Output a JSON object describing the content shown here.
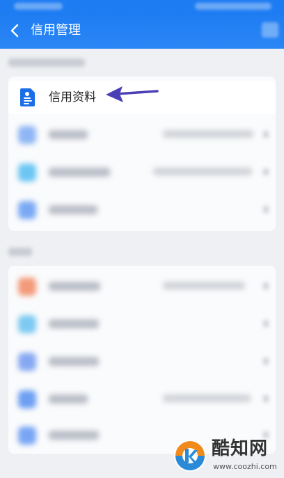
{
  "header": {
    "title": "信用管理",
    "back_icon": "chevron-left-icon",
    "accent_color": "#1e7cf2"
  },
  "credit_info": {
    "label": "信用资料",
    "icon": "document-icon",
    "icon_color": "#1a6fe8"
  },
  "annotation": {
    "arrow_color": "#4a3fb5"
  },
  "watermark": {
    "title": "酷知网",
    "url": "www.coozhi.com",
    "logo_orange": "#f08a1c",
    "logo_blue": "#2a8ad8"
  }
}
